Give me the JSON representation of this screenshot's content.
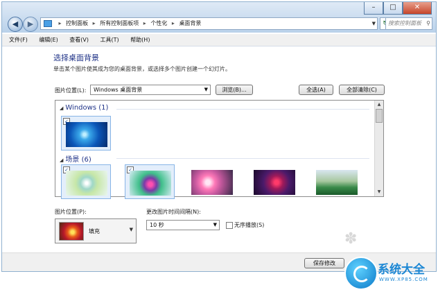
{
  "window": {
    "controls": [
      "–",
      "□",
      "✕"
    ],
    "nav_back": "◀",
    "nav_forward": "▶",
    "breadcrumb": [
      "控制面板",
      "所有控制面板项",
      "个性化",
      "桌面背景"
    ],
    "search_placeholder": "搜索控制面板"
  },
  "menu": [
    "文件(F)",
    "编辑(E)",
    "查看(V)",
    "工具(T)",
    "帮助(H)"
  ],
  "page": {
    "title": "选择桌面背景",
    "subtitle": "单击某个图片使其成为您的桌面背景，或选择多个图片创建一个幻灯片。",
    "location_label": "图片位置(L):",
    "location_value": "Windows 桌面背景",
    "browse_label": "浏览(B)...",
    "select_all_label": "全选(A)",
    "clear_all_label": "全部清除(C)"
  },
  "groups": [
    {
      "name": "Windows (1)",
      "items": [
        {
          "checked": true,
          "selected": true
        }
      ]
    },
    {
      "name": "场景 (6)",
      "items": [
        {
          "checked": true,
          "selected": true
        },
        {
          "checked": true,
          "selected": true
        },
        {
          "checked": false,
          "selected": false
        },
        {
          "checked": false,
          "selected": false
        },
        {
          "checked": false,
          "selected": false
        }
      ]
    }
  ],
  "position": {
    "label": "图片位置(P):",
    "value": "填充"
  },
  "interval": {
    "label": "更改图片时间间隔(N):",
    "value": "10 秒"
  },
  "shuffle": {
    "label": "无序播放(S)",
    "checked": false
  },
  "save_label": "保存修改",
  "watermark": {
    "name": "系统大全",
    "url": "WWW.XP85.COM"
  }
}
